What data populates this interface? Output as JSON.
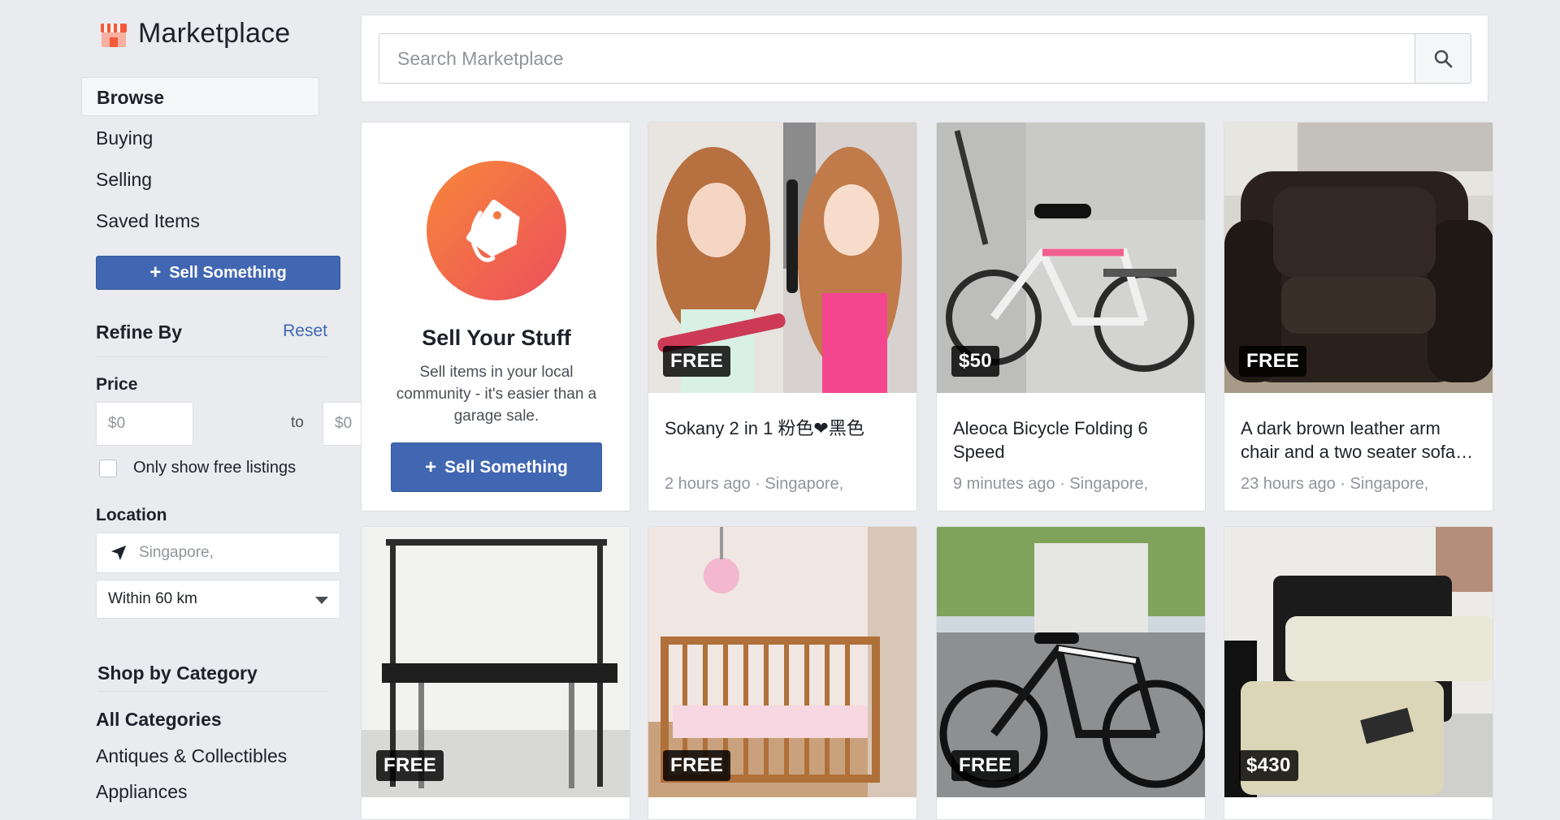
{
  "brand": {
    "title": "Marketplace",
    "icon": "storefront-icon",
    "accent": "#f25a3b"
  },
  "nav": [
    {
      "label": "Browse",
      "active": true
    },
    {
      "label": "Buying"
    },
    {
      "label": "Selling"
    },
    {
      "label": "Saved Items"
    }
  ],
  "sidebar": {
    "sell_button": "Sell Something",
    "refine_title": "Refine By",
    "reset": "Reset",
    "price_label": "Price",
    "price_min_placeholder": "$0",
    "price_max_placeholder": "$0",
    "price_to": "to",
    "free_only_label": "Only show free listings",
    "location_label": "Location",
    "location_value": "Singapore,",
    "radius_value": "Within 60 km",
    "shop_by_category": "Shop by Category",
    "categories": [
      "All Categories",
      "Antiques & Collectibles",
      "Appliances"
    ]
  },
  "search": {
    "placeholder": "Search Marketplace"
  },
  "promo": {
    "title": "Sell Your Stuff",
    "text": "Sell items in your local community - it's easier than a garage sale.",
    "button": "Sell Something"
  },
  "listings": [
    {
      "price": "FREE",
      "title": "Sokany 2 in 1 粉色❤黑色",
      "time": "2 hours ago",
      "location": "Singapore,"
    },
    {
      "price": "$50",
      "title": "Aleoca Bicycle Folding 6 Speed",
      "time": "9 minutes ago",
      "location": "Singapore,"
    },
    {
      "price": "FREE",
      "title": "A dark brown leather arm chair and a two seater sofa…",
      "time": "23 hours ago",
      "location": "Singapore,"
    },
    {
      "price": "FREE"
    },
    {
      "price": "FREE"
    },
    {
      "price": "FREE"
    },
    {
      "price": "$430"
    }
  ],
  "colors": {
    "primary": "#4267b2",
    "background": "#e9ebee",
    "muted": "#90949c"
  }
}
